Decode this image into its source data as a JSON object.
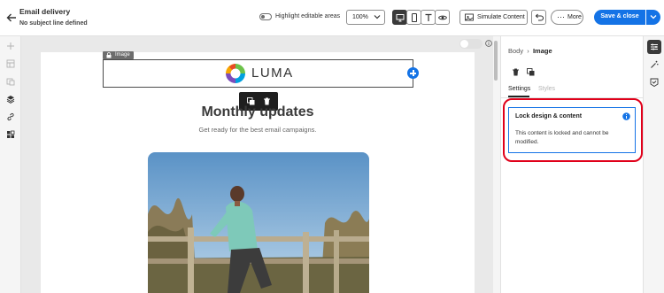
{
  "header": {
    "title": "Email delivery",
    "subtitle": "No subject line defined",
    "highlight_label": "Highlight editable areas",
    "zoom_value": "100%",
    "simulate_label": "Simulate Content",
    "more_label": "More",
    "save_label": "Save & close"
  },
  "canvas": {
    "image_badge": "Image",
    "logo_text": "LUMA",
    "heading": "Monthly updates",
    "subheading": "Get ready for the best email campaigns."
  },
  "panel": {
    "breadcrumb_parent": "Body",
    "breadcrumb_current": "Image",
    "tabs": [
      "Settings",
      "Styles"
    ],
    "lock_card": {
      "title": "Lock design & content",
      "description": "This content is locked and cannot be modified."
    }
  },
  "colors": {
    "accent": "#1473e6",
    "highlight_ring": "#e0001a",
    "toolbar_dark": "#1f1f1f"
  }
}
